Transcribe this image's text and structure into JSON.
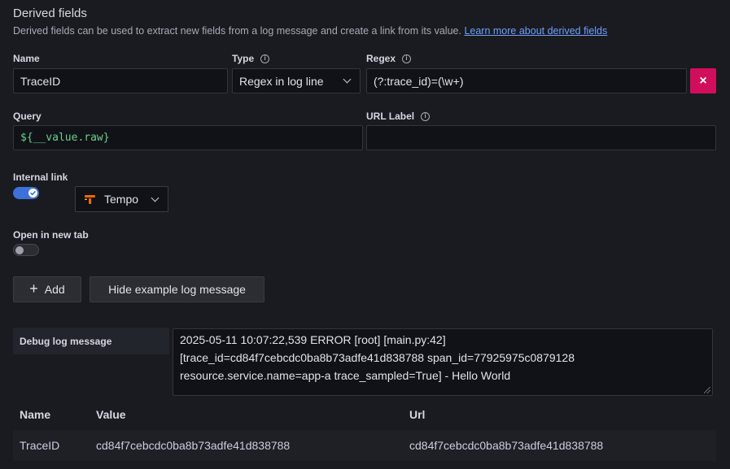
{
  "section": {
    "title": "Derived fields",
    "description": "Derived fields can be used to extract new fields from a log message and create a link from its value.",
    "learn_more": "Learn more about derived fields"
  },
  "form": {
    "name_label": "Name",
    "name_value": "TraceID",
    "type_label": "Type",
    "type_value": "Regex in log line",
    "regex_label": "Regex",
    "regex_value": "(?:trace_id)=(\\w+)",
    "delete_icon": "×",
    "query_label": "Query",
    "query_value": "${__value.raw}",
    "url_label_label": "URL Label",
    "url_label_value": "",
    "internal_link_label": "Internal link",
    "internal_link_on": true,
    "datasource_value": "Tempo",
    "new_tab_label": "Open in new tab",
    "new_tab_on": false
  },
  "actions": {
    "add_label": "Add",
    "add_icon": "+",
    "hide_example_label": "Hide example log message"
  },
  "debug": {
    "label": "Debug log message",
    "message_line1": "2025-05-11 10:07:22,539 ERROR [root] [main.py:42]",
    "message_line2": "[trace_id=cd84f7cebcdc0ba8b73adfe41d838788 span_id=77925975c0879128",
    "message_line3": "resource.service.name=app-a trace_sampled=True] - Hello World"
  },
  "results": {
    "headers": [
      "Name",
      "Value",
      "Url"
    ],
    "rows": [
      [
        "TraceID",
        "cd84f7cebcdc0ba8b73adfe41d838788",
        "cd84f7cebcdc0ba8b73adfe41d838788"
      ]
    ]
  },
  "colors": {
    "accent": "#3d71d9",
    "danger": "#d10e5c",
    "link": "#6e9fff",
    "tempo_brand": "#f46800"
  },
  "icons": {
    "info": "info-circle-icon",
    "tempo": "tempo-logo-icon",
    "check": "check-icon"
  }
}
